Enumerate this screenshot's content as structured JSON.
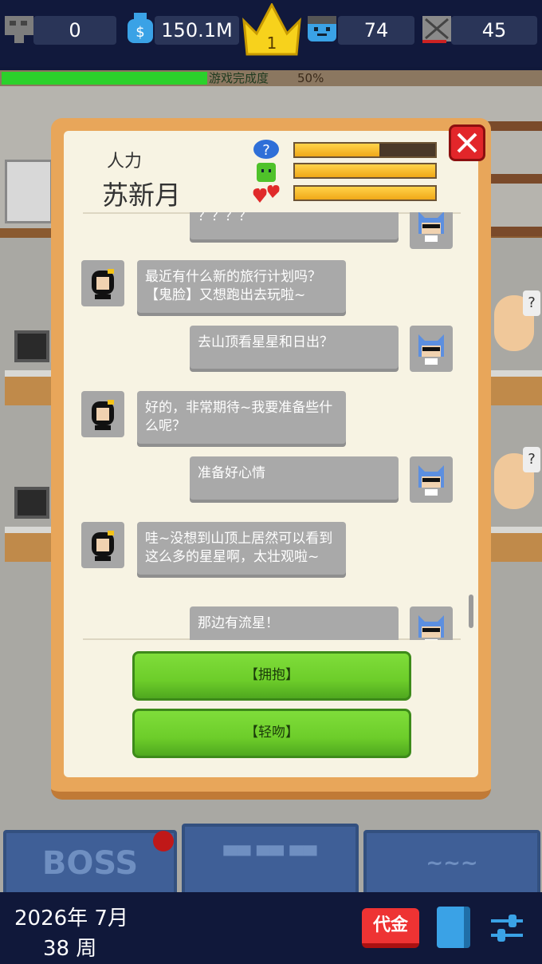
{
  "topbar": {
    "pending_count": "0",
    "money": "150.1M",
    "rank": "1",
    "employees": "74",
    "fights": "45",
    "progress_label": "游戏完成度",
    "progress_percent": "50%",
    "progress_value": 0.5
  },
  "dialog": {
    "role": "人力",
    "name": "苏新月",
    "bars": [
      {
        "icon": "question-heart-icon",
        "value": 0.6
      },
      {
        "icon": "green-face-icon",
        "value": 1.0
      },
      {
        "icon": "hearts-icon",
        "value": 1.0
      }
    ],
    "messages": [
      {
        "side": "right",
        "text": "？？？？"
      },
      {
        "side": "left",
        "text": "最近有什么新的旅行计划吗？【鬼脸】又想跑出去玩啦~"
      },
      {
        "side": "right",
        "text": "去山顶看星星和日出？"
      },
      {
        "side": "left",
        "text": "好的，非常期待~我要准备些什么呢？"
      },
      {
        "side": "right",
        "text": "准备好心情"
      },
      {
        "side": "left",
        "text": "哇~没想到山顶上居然可以看到这么多的星星啊，太壮观啦~"
      },
      {
        "side": "right",
        "text": "那边有流星！"
      }
    ],
    "choices": [
      "【拥抱】",
      "【轻吻】"
    ]
  },
  "bottom_nav": {
    "boss_label": "BOSS",
    "middle_label": "▀▀ ▀▀ ▀▀",
    "right_label": "~~~"
  },
  "footer": {
    "date": "2026年 7月",
    "week": "38 周",
    "voucher_label": "代金"
  },
  "colors": {
    "progress_green": "#2bd12b",
    "dialog_frame": "#e8a65a",
    "choice_green": "#6dcd2a",
    "close_red": "#e2262a"
  }
}
